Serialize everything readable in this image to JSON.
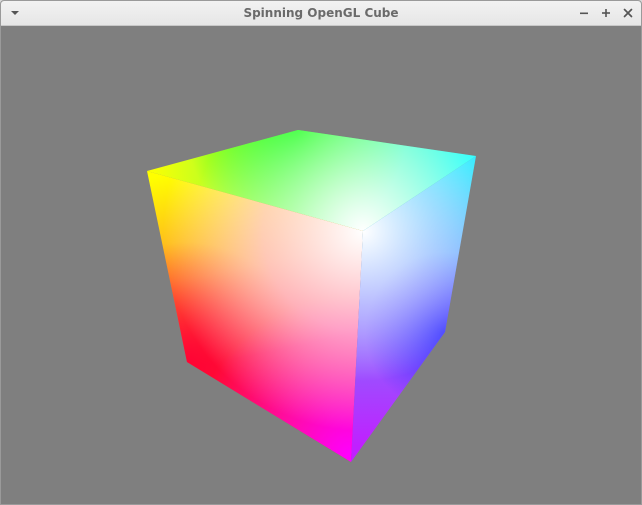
{
  "window": {
    "title": "Spinning OpenGL Cube",
    "controls": {
      "menu_icon": "triangle-down-icon",
      "minimize_icon": "minus-icon",
      "maximize_icon": "plus-icon",
      "close_icon": "x-icon"
    }
  },
  "scene": {
    "background_color": "#7f7f7f",
    "object": "rgb-color-cube",
    "corner_colors": {
      "yellow": "#ffff00",
      "green": "#00ff00",
      "cyan": "#00ffff",
      "white": "#ffffff",
      "red": "#ff0000",
      "magenta": "#ff00ff",
      "blue": "#0000ff"
    }
  }
}
